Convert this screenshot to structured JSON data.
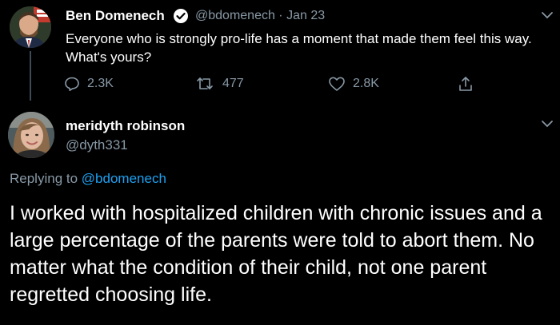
{
  "colors": {
    "background": "#000000",
    "text_primary": "#ffffff",
    "text_secondary": "#8899a6",
    "accent": "#1da1f2",
    "thread_line": "#3d4a56"
  },
  "parent_tweet": {
    "author_name": "Ben Domenech",
    "verified_icon": "verified-badge-icon",
    "meta": "@bdomenech · Jan 23",
    "text": "Everyone who is strongly pro-life has a moment that made them feel this way. What's yours?",
    "actions": {
      "reply_count": "2.3K",
      "retweet_count": "477",
      "like_count": "2.8K"
    }
  },
  "reply_tweet": {
    "author_name": "meridyth robinson",
    "handle": "@dyth331",
    "replying_prefix": "Replying to",
    "replying_mention": "@bdomenech",
    "text": "I worked with hospitalized children with chronic issues and a large percentage of the parents were told to abort them. No matter what the condition of their child, not one parent regretted choosing life."
  }
}
